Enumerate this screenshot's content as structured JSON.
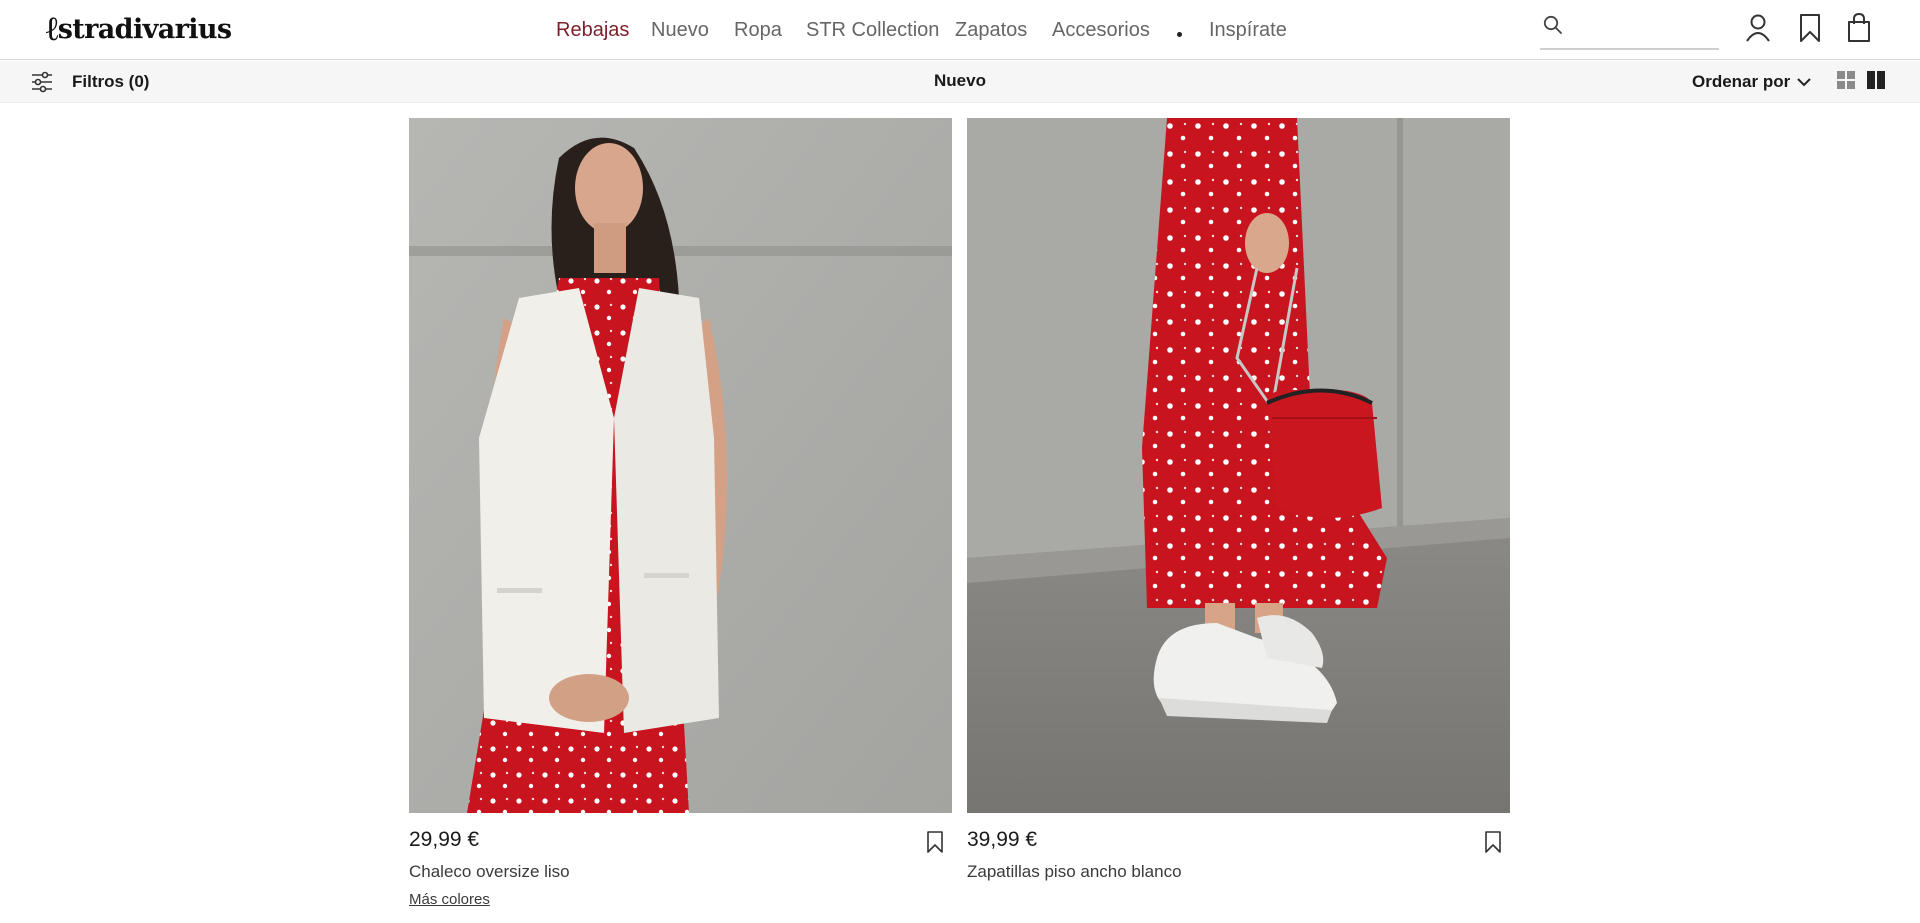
{
  "brand": {
    "logo_text": "stradivarius",
    "logo_mark": "ℓ"
  },
  "nav": {
    "items": [
      {
        "label": "Rebajas"
      },
      {
        "label": "Nuevo"
      },
      {
        "label": "Ropa"
      },
      {
        "label": "STR Collection"
      },
      {
        "label": "Zapatos"
      },
      {
        "label": "Accesorios"
      },
      {
        "label": "Inspírate"
      }
    ]
  },
  "search": {
    "value": "",
    "icon": "search-icon"
  },
  "header_icons": [
    "user-icon",
    "wishlist-icon",
    "bag-icon"
  ],
  "toolbar": {
    "filters_label": "Filtros (0)",
    "section_title": "Nuevo",
    "sort_label": "Ordenar por",
    "view_options": [
      "grid-small-icon",
      "grid-large-icon"
    ]
  },
  "products": [
    {
      "price": "29,99 €",
      "name": "Chaleco oversize liso",
      "more_colors": "Más colores"
    },
    {
      "price": "39,99 €",
      "name": "Zapatillas piso ancho blanco"
    }
  ],
  "colors": {
    "sale": "#7c1f2b",
    "dress_red": "#c8141e",
    "wall_grey": "#a7a7a5"
  }
}
